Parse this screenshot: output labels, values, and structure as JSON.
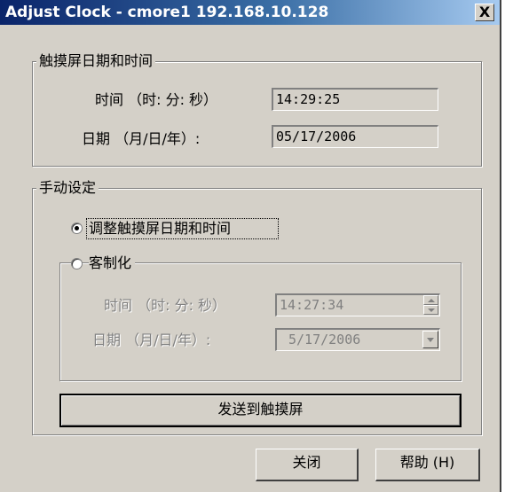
{
  "window": {
    "title": "Adjust Clock - cmore1 192.168.10.128",
    "close_glyph": "X"
  },
  "panel_display": {
    "legend": "触摸屏日期和时间",
    "time_label": "时间 （时: 分: 秒）",
    "time_value": "14:29:25",
    "date_label": "日期 （月/日/年）:",
    "date_value": "05/17/2006"
  },
  "panel_manual": {
    "legend": "手动设定",
    "option_sync": {
      "label": "调整触摸屏日期和时间",
      "selected": true
    },
    "option_custom": {
      "label": "客制化",
      "selected": false
    },
    "custom_time_label": "时间 （时: 分: 秒）",
    "custom_time_value": "14:27:34",
    "custom_date_label": "日期 （月/日/年）:",
    "custom_date_value": "5/17/2006",
    "send_button": "发送到触摸屏"
  },
  "footer": {
    "close_button": "关闭",
    "help_button": "帮助 (H)"
  },
  "icons": {
    "spin_up": "triangle-up",
    "spin_down": "triangle-down",
    "dropdown": "triangle-down"
  },
  "colors": {
    "dialog_bg": "#d4d0c8",
    "title_start": "#0a246a",
    "title_end": "#a6caf0",
    "disabled_text": "#808080"
  }
}
